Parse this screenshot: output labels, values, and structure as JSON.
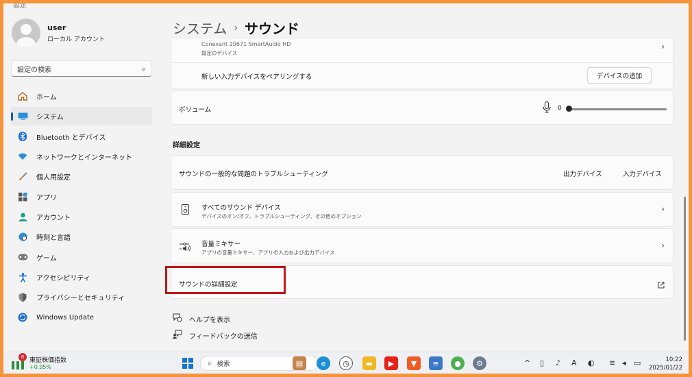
{
  "window": {
    "title_fragment": "設定"
  },
  "profile": {
    "name": "user",
    "account_type": "ローカル アカウント"
  },
  "search": {
    "placeholder": "設定の検索"
  },
  "nav": [
    {
      "label": "ホーム",
      "icon": "home-icon"
    },
    {
      "label": "システム",
      "icon": "system-icon"
    },
    {
      "label": "Bluetooth とデバイス",
      "icon": "bluetooth-icon"
    },
    {
      "label": "ネットワークとインターネット",
      "icon": "wifi-icon"
    },
    {
      "label": "個人用設定",
      "icon": "brush-icon"
    },
    {
      "label": "アプリ",
      "icon": "apps-icon"
    },
    {
      "label": "アカウント",
      "icon": "account-icon"
    },
    {
      "label": "時刻と言語",
      "icon": "globe-icon"
    },
    {
      "label": "ゲーム",
      "icon": "gamepad-icon"
    },
    {
      "label": "アクセシビリティ",
      "icon": "accessibility-icon"
    },
    {
      "label": "プライバシーとセキュリティ",
      "icon": "shield-icon"
    },
    {
      "label": "Windows Update",
      "icon": "update-icon"
    }
  ],
  "breadcrumb": {
    "parent": "システム",
    "separator": "›",
    "current": "サウンド"
  },
  "input_device": {
    "name": "Conexant 20671 SmartAudio HD",
    "sub": "既定のデバイス"
  },
  "pair": {
    "label": "新しい入力デバイスをペアリングする",
    "button": "デバイスの追加"
  },
  "volume": {
    "label": "ボリューム",
    "value": "0",
    "level": 0
  },
  "advanced": {
    "section_title": "詳細設定",
    "troubleshoot": {
      "label": "サウンドの一般的な問題のトラブルシューティング",
      "output": "出力デバイス",
      "input": "入力デバイス"
    },
    "all_devices": {
      "label": "すべてのサウンド デバイス",
      "sub": "デバイスのオン/オフ、トラブルシューティング、その他のオプション"
    },
    "mixer": {
      "label": "音量ミキサー",
      "sub": "アプリの音量ミキサー、アプリの入力および出力デバイス"
    },
    "more": {
      "label": "サウンドの詳細設定"
    }
  },
  "help": {
    "get_help": "ヘルプを表示",
    "feedback": "フィードバックの送信"
  },
  "taskbar": {
    "stock_name": "東証株価指数",
    "stock_change": "+0.95%",
    "stock_badge": "8",
    "search_label": "検索",
    "time": "10:22",
    "date": "2025/01/22",
    "ime": "A"
  },
  "colors": {
    "accent": "#1a5fb4",
    "highlight": "#c0161c",
    "frame": "#f5943a"
  }
}
